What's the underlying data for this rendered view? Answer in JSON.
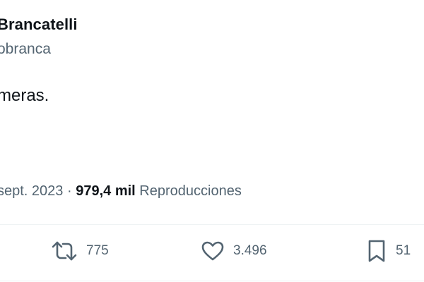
{
  "tweet": {
    "author_name": "Brancatelli",
    "author_handle": "obranca",
    "text": "meras.",
    "date": "sept. 2023",
    "separator": "·",
    "views_count": "979,4 mil",
    "views_label": "Reproducciones"
  },
  "actions": {
    "retweets": {
      "icon": "retweet-icon",
      "count": "775"
    },
    "likes": {
      "icon": "heart-icon",
      "count": "3.496"
    },
    "bookmarks": {
      "icon": "bookmark-icon",
      "count": "51"
    }
  },
  "colors": {
    "text_primary": "#0f1419",
    "text_secondary": "#536471",
    "divider": "#eff3f4"
  }
}
